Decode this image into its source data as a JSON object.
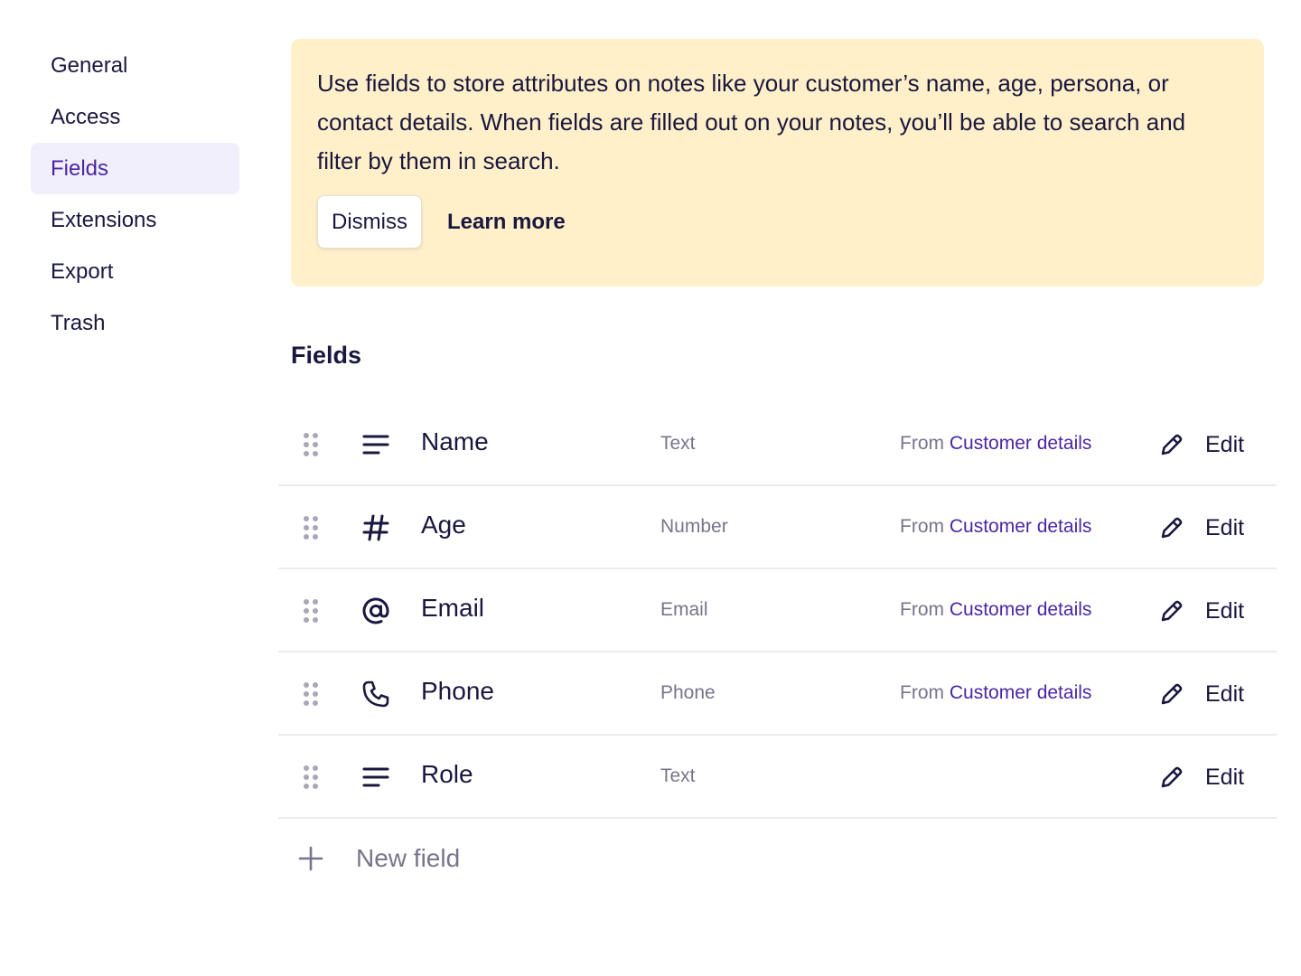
{
  "sidebar": {
    "items": [
      {
        "label": "General",
        "active": false
      },
      {
        "label": "Access",
        "active": false
      },
      {
        "label": "Fields",
        "active": true
      },
      {
        "label": "Extensions",
        "active": false
      },
      {
        "label": "Export",
        "active": false
      },
      {
        "label": "Trash",
        "active": false
      }
    ]
  },
  "banner": {
    "text": "Use fields to store attributes on notes like your customer’s name, age, persona, or contact details. When fields are filled out on your notes, you’ll be able to search and filter by them in search.",
    "dismiss_label": "Dismiss",
    "learn_more_label": "Learn more",
    "background": "#fff0c9"
  },
  "section": {
    "title": "Fields"
  },
  "fields": [
    {
      "icon": "text-lines-icon",
      "name": "Name",
      "type": "Text",
      "source_prefix": "From",
      "source_name": "Customer details",
      "edit_label": "Edit"
    },
    {
      "icon": "hash-icon",
      "name": "Age",
      "type": "Number",
      "source_prefix": "From",
      "source_name": "Customer details",
      "edit_label": "Edit"
    },
    {
      "icon": "at-sign-icon",
      "name": "Email",
      "type": "Email",
      "source_prefix": "From",
      "source_name": "Customer details",
      "edit_label": "Edit"
    },
    {
      "icon": "phone-icon",
      "name": "Phone",
      "type": "Phone",
      "source_prefix": "From",
      "source_name": "Customer details",
      "edit_label": "Edit"
    },
    {
      "icon": "text-lines-icon",
      "name": "Role",
      "type": "Text",
      "source_prefix": "",
      "source_name": "",
      "edit_label": "Edit"
    }
  ],
  "new_field": {
    "label": "New field",
    "icon": "plus-icon"
  },
  "colors": {
    "accent": "#4a26a6",
    "text": "#1a1740",
    "muted": "#77758c",
    "active_nav_bg": "#f0effb"
  }
}
